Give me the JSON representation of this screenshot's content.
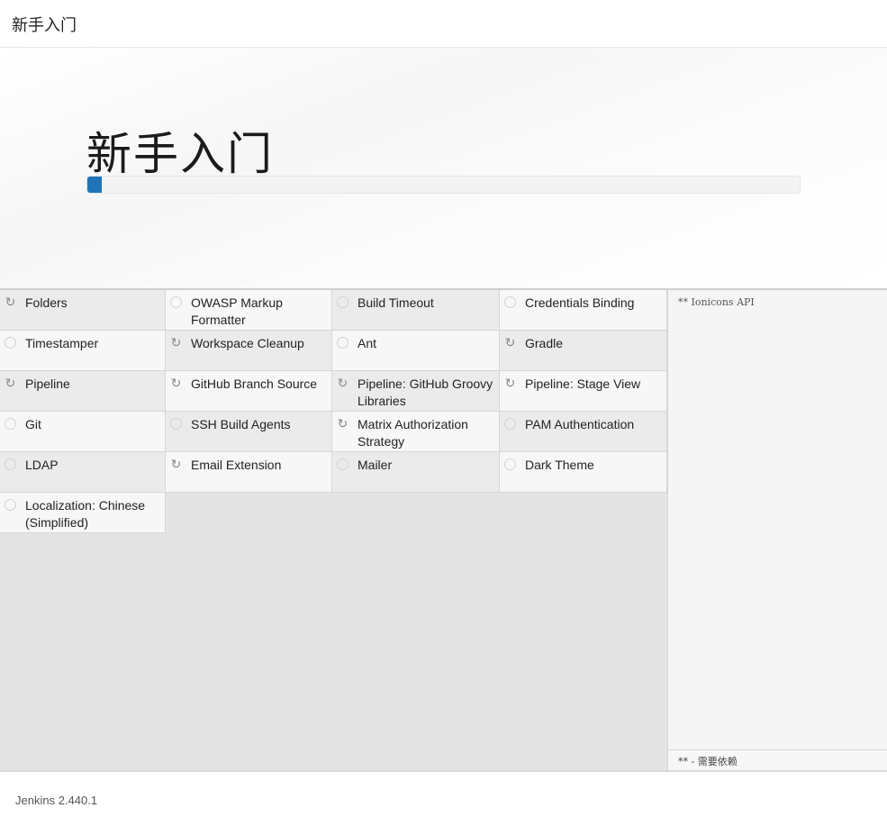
{
  "header": {
    "title": "新手入门"
  },
  "hero": {
    "heading": "新手入门",
    "progress_fraction": 0.003
  },
  "plugins": [
    {
      "name": "Folders",
      "status": "installing"
    },
    {
      "name": "OWASP Markup Formatter",
      "status": "pending"
    },
    {
      "name": "Build Timeout",
      "status": "pending"
    },
    {
      "name": "Credentials Binding",
      "status": "pending"
    },
    {
      "name": "Timestamper",
      "status": "pending"
    },
    {
      "name": "Workspace Cleanup",
      "status": "installing"
    },
    {
      "name": "Ant",
      "status": "pending"
    },
    {
      "name": "Gradle",
      "status": "installing"
    },
    {
      "name": "Pipeline",
      "status": "installing"
    },
    {
      "name": "GitHub Branch Source",
      "status": "installing"
    },
    {
      "name": "Pipeline: GitHub Groovy Libraries",
      "status": "installing"
    },
    {
      "name": "Pipeline: Stage View",
      "status": "installing"
    },
    {
      "name": "Git",
      "status": "pending"
    },
    {
      "name": "SSH Build Agents",
      "status": "pending"
    },
    {
      "name": "Matrix Authorization Strategy",
      "status": "installing"
    },
    {
      "name": "PAM Authentication",
      "status": "pending"
    },
    {
      "name": "LDAP",
      "status": "pending"
    },
    {
      "name": "Email Extension",
      "status": "installing"
    },
    {
      "name": "Mailer",
      "status": "pending"
    },
    {
      "name": "Dark Theme",
      "status": "pending"
    },
    {
      "name": "Localization: Chinese (Simplified)",
      "status": "pending"
    }
  ],
  "log": {
    "current": "** Ionicons API",
    "legend": "** - 需要依赖"
  },
  "footer": {
    "version": "Jenkins 2.440.1"
  },
  "colors": {
    "progress": "#1f75b8",
    "grid_bg": "#e4e4e4"
  },
  "icons": {
    "installing": "refresh-icon",
    "pending": "circle-icon"
  }
}
